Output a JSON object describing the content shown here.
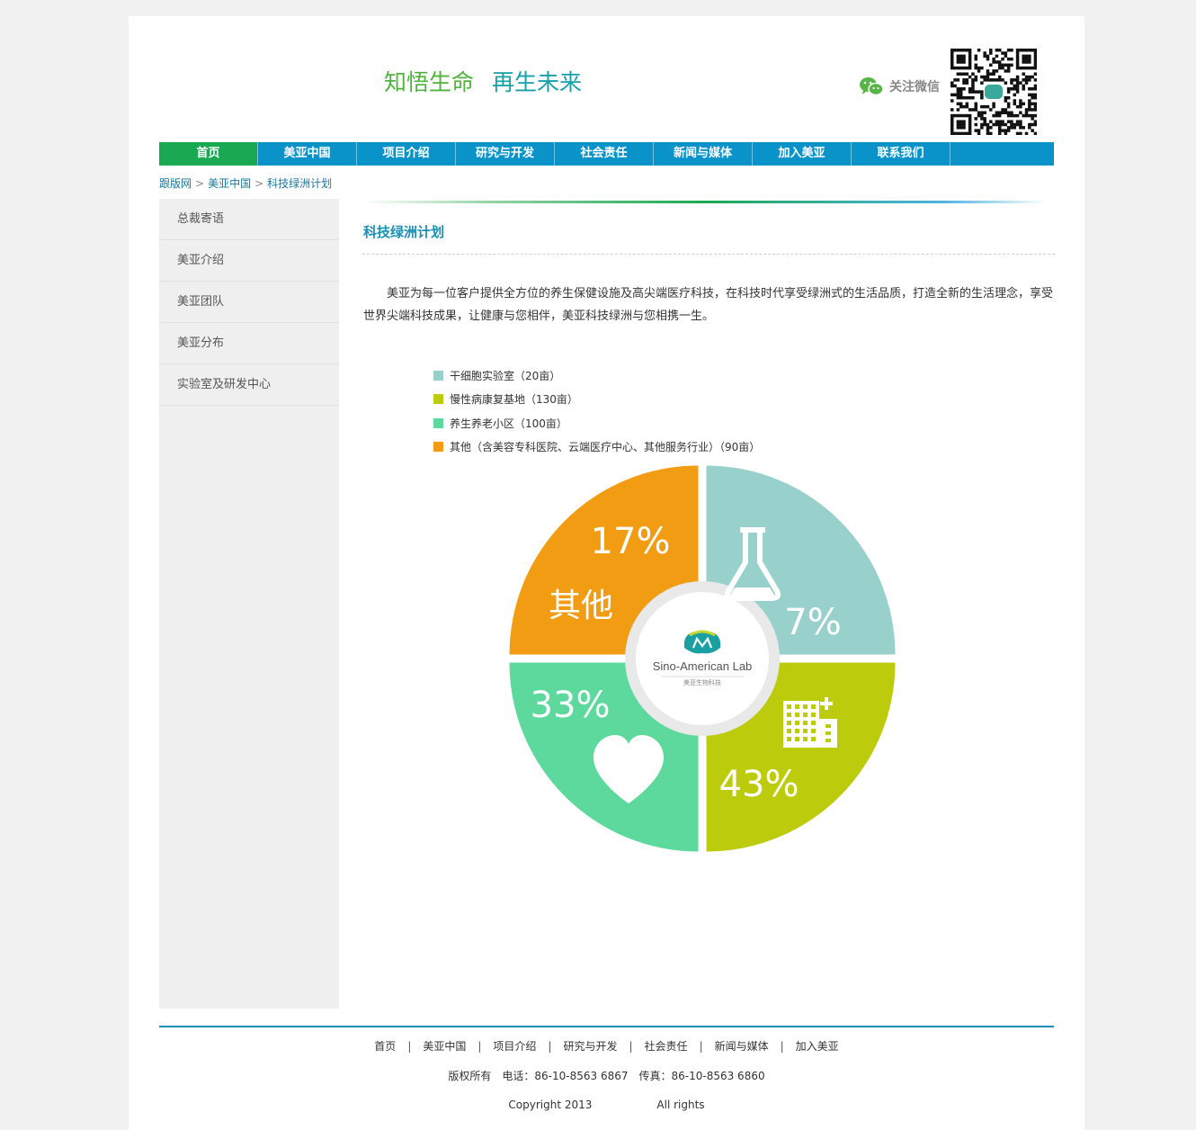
{
  "header": {
    "slogan_1": "知悟生命",
    "slogan_2": "再生未来",
    "follow_wechat": "关注微信"
  },
  "nav": {
    "items": [
      "首页",
      "美亚中国",
      "项目介绍",
      "研究与开发",
      "社会责任",
      "新闻与媒体",
      "加入美亚",
      "联系我们"
    ],
    "active_index": 0
  },
  "breadcrumb": [
    "跟版网",
    "美亚中国",
    "科技绿洲计划"
  ],
  "sidebar": {
    "items": [
      "总裁寄语",
      "美亚介绍",
      "美亚团队",
      "美亚分布",
      "实验室及研发中心"
    ]
  },
  "main": {
    "title": "科技绿洲计划",
    "intro": "美亚为每一位客户提供全方位的养生保健设施及高尖端医疗科技，在科技时代享受绿洲式的生活品质，打造全新的生活理念，享受世界尖端科技成果，让健康与您相伴，美亚科技绿洲与您相携一生。"
  },
  "chart_data": {
    "type": "pie",
    "series": [
      {
        "name": "干细胞实验室（20亩）",
        "value": 7,
        "label": "7%",
        "color": "#98d1cb",
        "icon": "flask-icon"
      },
      {
        "name": "慢性病康复基地（130亩）",
        "value": 43,
        "label": "43%",
        "color": "#bccb0c",
        "icon": "building-icon"
      },
      {
        "name": "养生养老小区（100亩）",
        "value": 33,
        "label": "33%",
        "color": "#5ed99e",
        "icon": "heart-icon"
      },
      {
        "name": "其他（含美容专科医院、云端医疗中心、其他服务行业）（90亩）",
        "value": 17,
        "label": "17%",
        "color": "#f29c13",
        "icon": "",
        "sub_label": "其他"
      }
    ],
    "center_logo": {
      "text": "Sino-American Lab",
      "subtext": "美亚生物科技"
    }
  },
  "footer": {
    "nav": [
      "首页",
      "美亚中国",
      "项目介绍",
      "研究与开发",
      "社会责任",
      "新闻与媒体",
      "加入美亚"
    ],
    "rights_label": "版权所有",
    "phone": "电话：86-10-8563 6867",
    "fax": "传真：86-10-8563 6860",
    "copyright": "Copyright 2013",
    "all_rights": "All rights"
  }
}
